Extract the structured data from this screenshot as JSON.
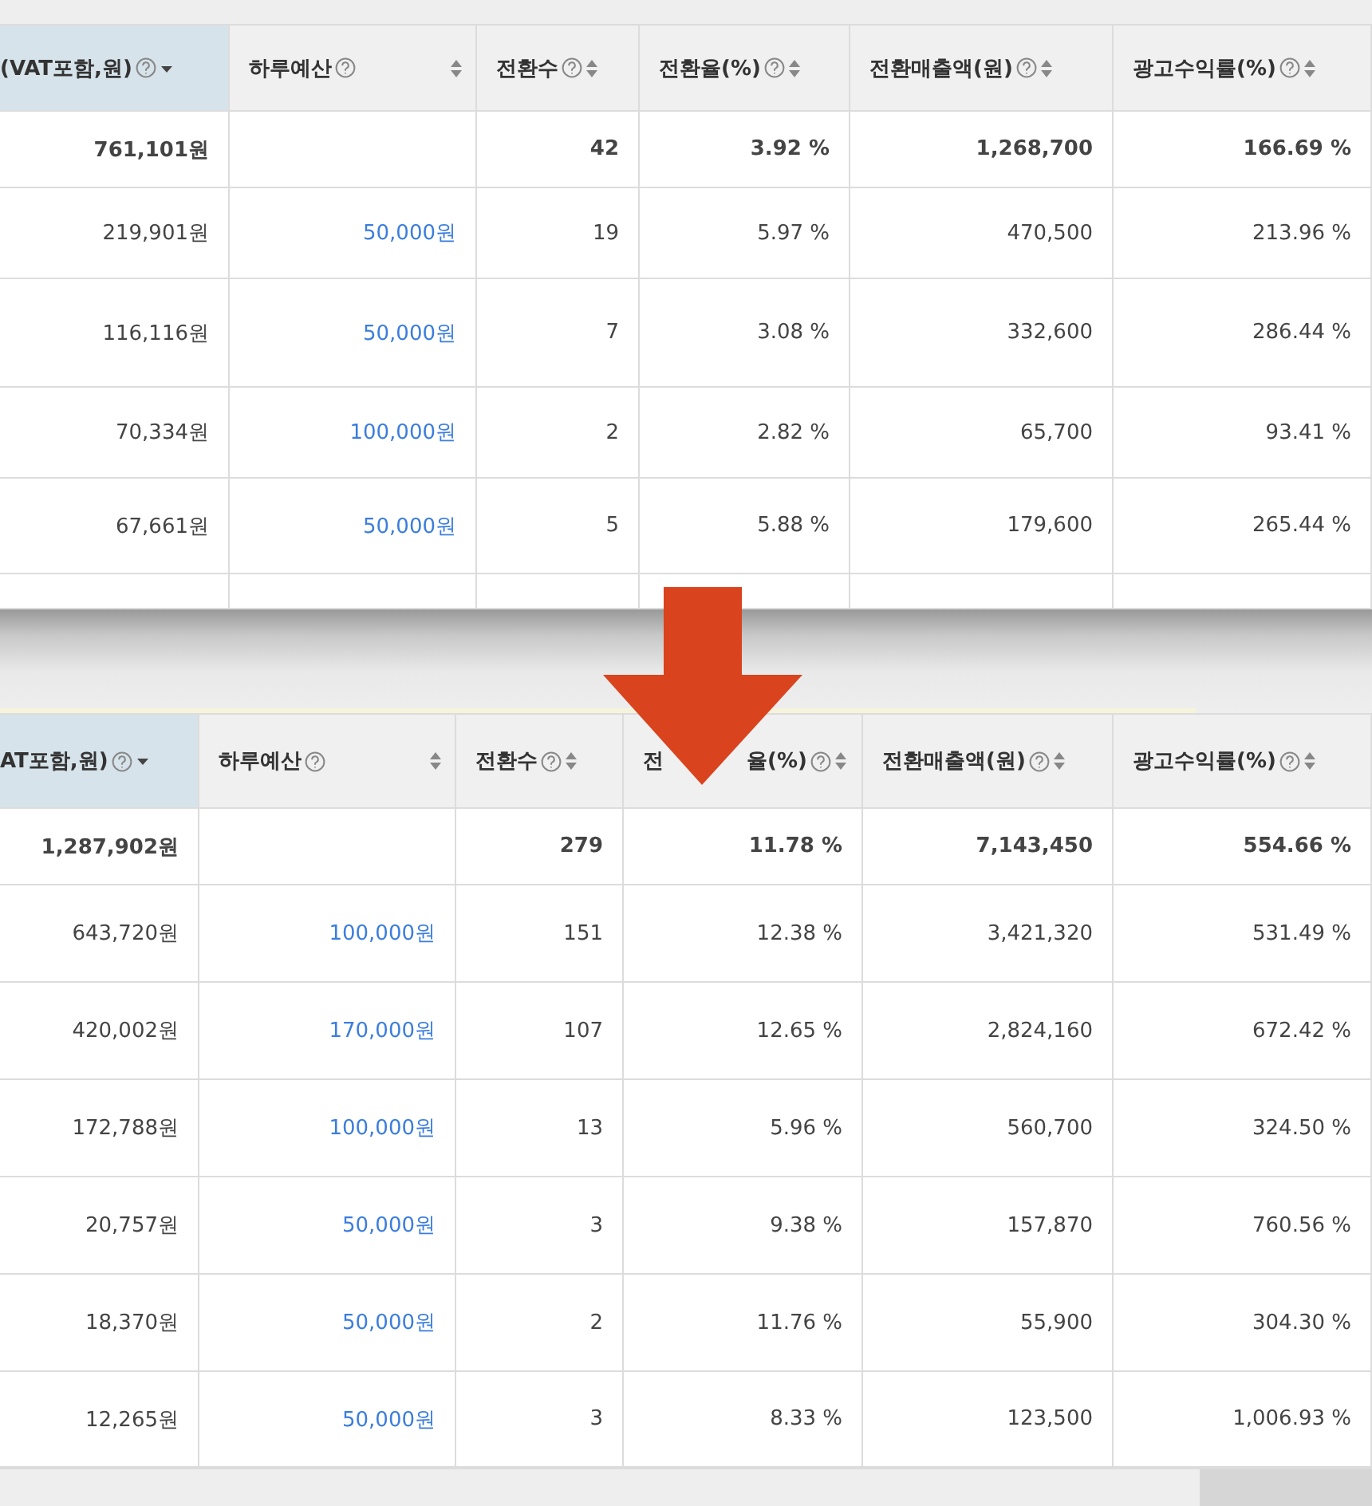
{
  "panels": [
    {
      "columns": [
        {
          "label": "(VAT포함,원)",
          "sorted": true,
          "kind": "number"
        },
        {
          "label": "하루예산",
          "sorted": false,
          "kind": "link"
        },
        {
          "label": "전환수",
          "sorted": false,
          "kind": "number"
        },
        {
          "label": "전환율(%)",
          "sorted": false,
          "kind": "number"
        },
        {
          "label": "전환매출액(원)",
          "sorted": false,
          "kind": "number"
        },
        {
          "label": "광고수익률(%)",
          "sorted": false,
          "kind": "number"
        }
      ],
      "total": {
        "column_1": "761,101원",
        "column_3": "42",
        "column_4": "3.92 %",
        "column_5": "1,268,700",
        "column_6": "166.69 %"
      },
      "rows": [
        [
          "219,901원",
          "50,000원",
          "19",
          "5.97 %",
          "470,500",
          "213.96 %"
        ],
        [
          "116,116원",
          "50,000원",
          "7",
          "3.08 %",
          "332,600",
          "286.44 %"
        ],
        [
          "70,334원",
          "100,000원",
          "2",
          "2.82 %",
          "65,700",
          "93.41 %"
        ],
        [
          "67,661원",
          "50,000원",
          "5",
          "5.88 %",
          "179,600",
          "265.44 %"
        ]
      ]
    },
    {
      "columns": [
        {
          "label": "AT포함,원)",
          "sorted": true,
          "kind": "number"
        },
        {
          "label": "하루예산",
          "sorted": false,
          "kind": "link"
        },
        {
          "label": "전환수",
          "sorted": false,
          "kind": "number"
        },
        {
          "label_parts": [
            "전",
            "율(%)"
          ],
          "sorted": false,
          "kind": "number"
        },
        {
          "label": "전환매출액(원)",
          "sorted": false,
          "kind": "number"
        },
        {
          "label": "광고수익률(%)",
          "sorted": false,
          "kind": "number"
        }
      ],
      "total": {
        "column_1": "1,287,902원",
        "column_3": "279",
        "column_4": "11.78 %",
        "column_5": "7,143,450",
        "column_6": "554.66 %"
      },
      "rows": [
        [
          "643,720원",
          "100,000원",
          "151",
          "12.38 %",
          "3,421,320",
          "531.49 %"
        ],
        [
          "420,002원",
          "170,000원",
          "107",
          "12.65 %",
          "2,824,160",
          "672.42 %"
        ],
        [
          "172,788원",
          "100,000원",
          "13",
          "5.96 %",
          "560,700",
          "324.50 %"
        ],
        [
          "20,757원",
          "50,000원",
          "3",
          "9.38 %",
          "157,870",
          "760.56 %"
        ],
        [
          "18,370원",
          "50,000원",
          "2",
          "11.76 %",
          "55,900",
          "304.30 %"
        ],
        [
          "12,265원",
          "50,000원",
          "3",
          "8.33 %",
          "123,500",
          "1,006.93 %"
        ]
      ]
    }
  ]
}
